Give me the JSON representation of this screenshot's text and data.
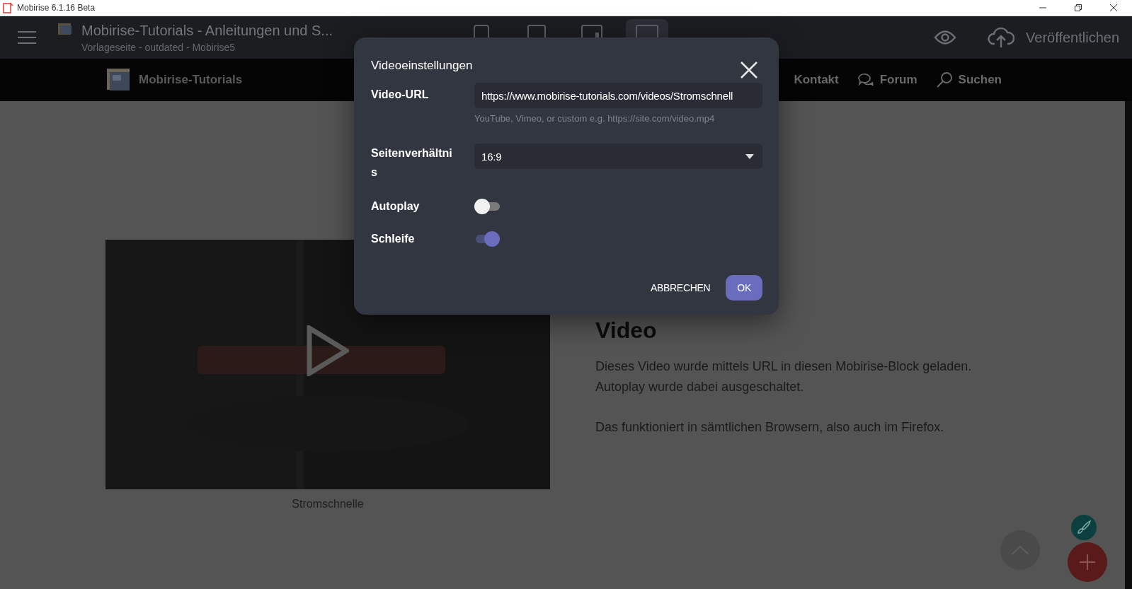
{
  "window": {
    "title": "Mobirise 6.1.16 Beta"
  },
  "toolbar": {
    "project_title": "Mobirise-Tutorials - Anleitungen und S...",
    "page_subtitle": "Vorlageseite - outdated - Mobirise5",
    "devices": [
      {
        "kind": "phone",
        "selected": false
      },
      {
        "kind": "tablet",
        "selected": false
      },
      {
        "kind": "tablet-wide",
        "selected": false
      },
      {
        "kind": "desktop",
        "selected": true
      }
    ],
    "publish_label": "Veröffentlichen"
  },
  "site_nav": {
    "brand": "Mobirise-Tutorials",
    "items": [
      {
        "label": "Kontakt",
        "kind": "plain"
      },
      {
        "label": "Forum",
        "kind": "chat"
      },
      {
        "label": "Suchen",
        "kind": "search"
      }
    ]
  },
  "content": {
    "caption": "Stromschnelle",
    "heading": "Video",
    "paragraphs": [
      "Dieses Video wurde mittels URL in diesen Mobirise-Block geladen. Autoplay wurde dabei ausgeschaltet.",
      "Das funktioniert in sämtlichen Browsern, also auch im Firefox."
    ]
  },
  "dialog": {
    "title": "Videoeinstellungen",
    "url_label": "Video-URL",
    "url_value": "https://www.mobirise-tutorials.com/videos/Stromschnell",
    "url_hint": "YouTube, Vimeo, or custom e.g. https://site.com/video.mp4",
    "ratio_label": "Seitenverhältnis",
    "ratio_value": "16:9",
    "toggles": [
      {
        "label": "Autoplay",
        "on": false
      },
      {
        "label": "Schleife",
        "on": true
      }
    ],
    "buttons": [
      {
        "label": "ABBRECHEN",
        "kind": "text"
      },
      {
        "label": "OK",
        "kind": "primary"
      }
    ]
  }
}
